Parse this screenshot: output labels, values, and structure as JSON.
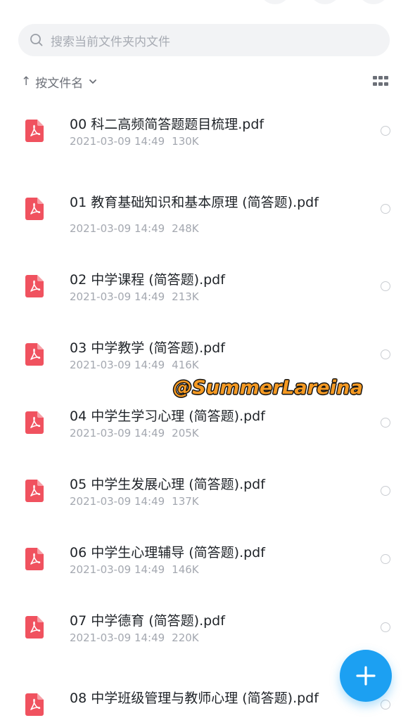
{
  "search": {
    "placeholder": "搜索当前文件夹内文件"
  },
  "sort": {
    "arrow": "↑",
    "label": "按文件名"
  },
  "files": [
    {
      "name": "00 科二高频简答题题目梳理.pdf",
      "date": "2021-03-09 14:49",
      "size": "130K"
    },
    {
      "name": "01 教育基础知识和基本原理 (简答题).pdf",
      "date": "2021-03-09 14:49",
      "size": "248K"
    },
    {
      "name": "02 中学课程 (简答题).pdf",
      "date": "2021-03-09 14:49",
      "size": "213K"
    },
    {
      "name": "03 中学教学 (简答题).pdf",
      "date": "2021-03-09 14:49",
      "size": "416K"
    },
    {
      "name": "04 中学生学习心理 (简答题).pdf",
      "date": "2021-03-09 14:49",
      "size": "205K"
    },
    {
      "name": "05 中学生发展心理 (简答题).pdf",
      "date": "2021-03-09 14:49",
      "size": "137K"
    },
    {
      "name": "06 中学生心理辅导 (简答题).pdf",
      "date": "2021-03-09 14:49",
      "size": "146K"
    },
    {
      "name": "07 中学德育 (简答题).pdf",
      "date": "2021-03-09 14:49",
      "size": "220K"
    },
    {
      "name": "08 中学班级管理与教师心理 (简答题).pdf",
      "date": "",
      "size": ""
    }
  ],
  "watermark": "@SummerLareina",
  "icons": {
    "search": "search-icon",
    "grid": "grid-view-icon",
    "pdf": "pdf-file-icon",
    "add": "plus-icon"
  },
  "colors": {
    "pdf": "#f0525f",
    "accent": "#1ca0f2",
    "watermark": "#f59a23"
  }
}
